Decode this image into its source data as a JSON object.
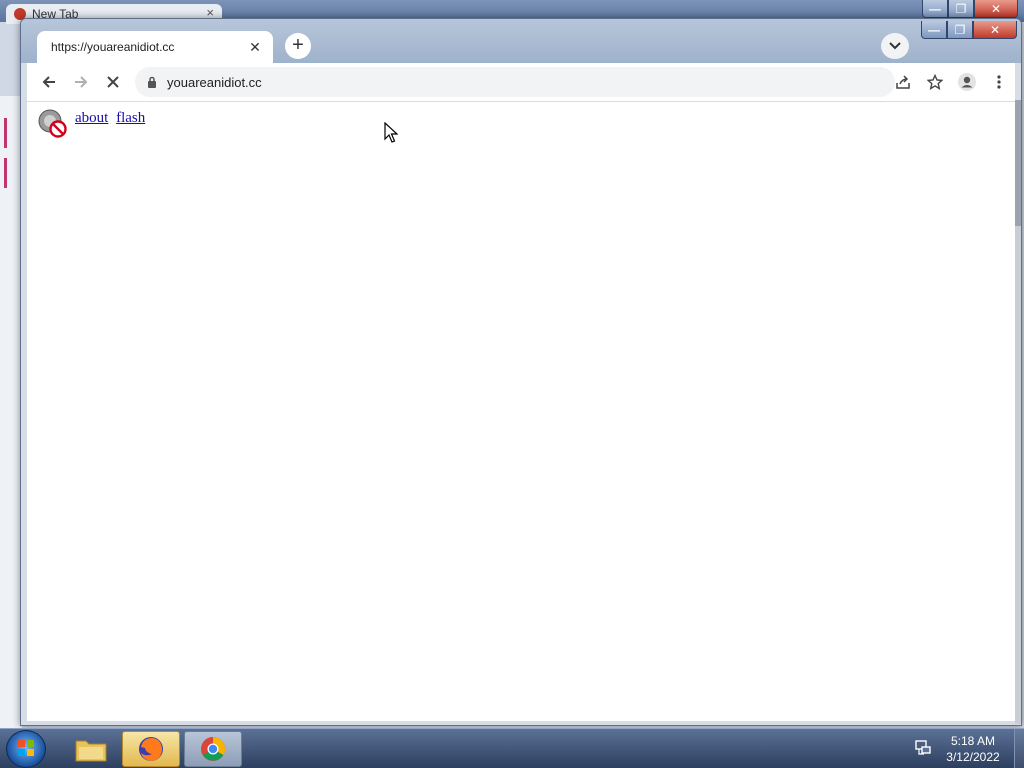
{
  "background_window": {
    "tab_title": "New Tab",
    "minimize_symbol": "—",
    "restore_symbol": "❐",
    "close_symbol": "✕"
  },
  "browser": {
    "tab": {
      "title": "https://youareanidiot.cc",
      "close_symbol": "✕"
    },
    "new_tab_symbol": "+",
    "window_controls": {
      "minimize_symbol": "—",
      "restore_symbol": "❐",
      "close_symbol": "✕"
    },
    "address_bar": {
      "url": "youareanidiot.cc",
      "secure": true
    },
    "loading": true
  },
  "page": {
    "links": [
      {
        "label": "about"
      },
      {
        "label": "flash"
      }
    ],
    "plugin_icon": "blocked-flash-icon"
  },
  "taskbar": {
    "items": [
      "windows-explorer-icon",
      "firefox-icon",
      "chrome-icon"
    ],
    "clock": {
      "time": "5:18 AM",
      "date": "3/12/2022"
    }
  },
  "colors": {
    "link": "#1a0dab",
    "taskbar": "#2d3f5f",
    "tab_active": "#ffffff"
  }
}
